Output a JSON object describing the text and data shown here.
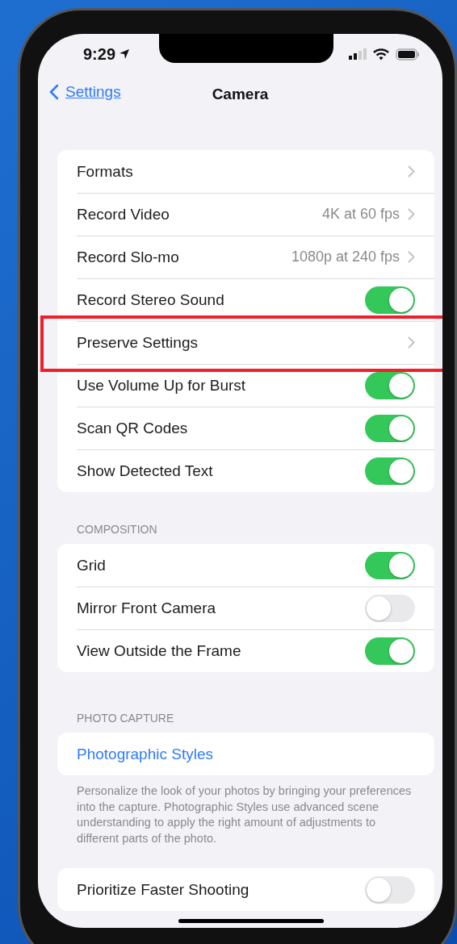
{
  "status_bar": {
    "time": "9:29"
  },
  "nav": {
    "back": "Settings",
    "title": "Camera"
  },
  "sections": [
    {
      "rows": [
        {
          "kind": "link",
          "label": "Formats",
          "highlighted": false
        },
        {
          "kind": "link",
          "label": "Record Video",
          "value": "4K at 60 fps",
          "highlighted": false
        },
        {
          "kind": "link",
          "label": "Record Slo-mo",
          "value": "1080p at 240 fps",
          "highlighted": false
        },
        {
          "kind": "toggle",
          "label": "Record Stereo Sound",
          "on": true,
          "highlighted": false
        },
        {
          "kind": "link",
          "label": "Preserve Settings",
          "highlighted": true
        },
        {
          "kind": "toggle",
          "label": "Use Volume Up for Burst",
          "on": true,
          "highlighted": false
        },
        {
          "kind": "toggle",
          "label": "Scan QR Codes",
          "on": true,
          "highlighted": false
        },
        {
          "kind": "toggle",
          "label": "Show Detected Text",
          "on": true,
          "highlighted": false
        }
      ]
    },
    {
      "header": "COMPOSITION",
      "rows": [
        {
          "kind": "toggle",
          "label": "Grid",
          "on": true,
          "highlighted": false
        },
        {
          "kind": "toggle",
          "label": "Mirror Front Camera",
          "on": false,
          "highlighted": false
        },
        {
          "kind": "toggle",
          "label": "View Outside the Frame",
          "on": true,
          "highlighted": false
        }
      ]
    },
    {
      "header": "PHOTO CAPTURE",
      "rows": [
        {
          "kind": "action",
          "label": "Photographic Styles",
          "highlighted": false
        }
      ],
      "footer": "Personalize the look of your photos by bringing your preferences into the capture. Photographic Styles use advanced scene understanding to apply the right amount of adjustments to different parts of the photo."
    },
    {
      "rows": [
        {
          "kind": "toggle",
          "label": "Prioritize Faster Shooting",
          "on": false,
          "highlighted": false
        }
      ]
    }
  ]
}
